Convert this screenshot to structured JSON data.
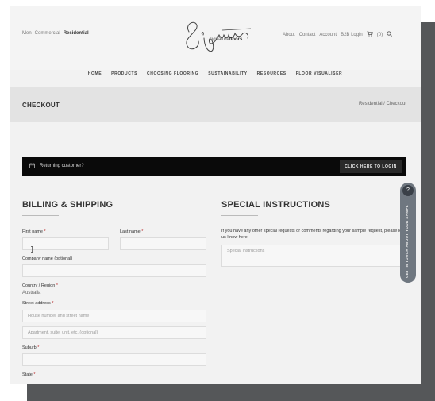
{
  "header": {
    "region_links": {
      "men": "Men",
      "commercial": "Commercial",
      "residential": "Residential"
    },
    "logo_sub_plain": "signature",
    "logo_sub_bold": "floors",
    "util": {
      "about": "About",
      "contact": "Contact",
      "account": "Account",
      "b2b": "B2B Login",
      "cart_count": "(0)"
    }
  },
  "nav": [
    "HOME",
    "PRODUCTS",
    "CHOOSING FLOORING",
    "SUSTAINABILITY",
    "RESOURCES",
    "FLOOR VISUALISER"
  ],
  "title_band": {
    "title": "CHECKOUT",
    "crumbs": "Residential / Checkout"
  },
  "returning": {
    "text": "Returning customer?",
    "button": "CLICK HERE TO LOGIN"
  },
  "billing": {
    "title": "BILLING & SHIPPING",
    "first_name": "First name",
    "last_name": "Last name",
    "company": "Company name (optional)",
    "country_label": "Country / Region",
    "country_value": "Australia",
    "street_label": "Street address",
    "street_placeholder": "House number and street name",
    "apartment_placeholder": "Apartment, suite, unit, etc. (optional)",
    "suburb": "Suburb",
    "state": "State",
    "required_mark": "*"
  },
  "special": {
    "title": "SPECIAL INSTRUCTIONS",
    "text": "If you have any other special requests or comments regarding your sample request, please let us know here.",
    "placeholder": "Special instructions"
  },
  "side_tab": {
    "badge": "?",
    "label": "GET IN TOUCH ABOUT YOUR SAMPLES"
  },
  "colors": {
    "dark_bar": "#0a0a0a",
    "side_tab": "#6f7780",
    "page_bg": "#f2f2f2"
  },
  "icons": [
    "calendar-icon",
    "cart-icon",
    "search-icon",
    "text-cursor-icon"
  ]
}
